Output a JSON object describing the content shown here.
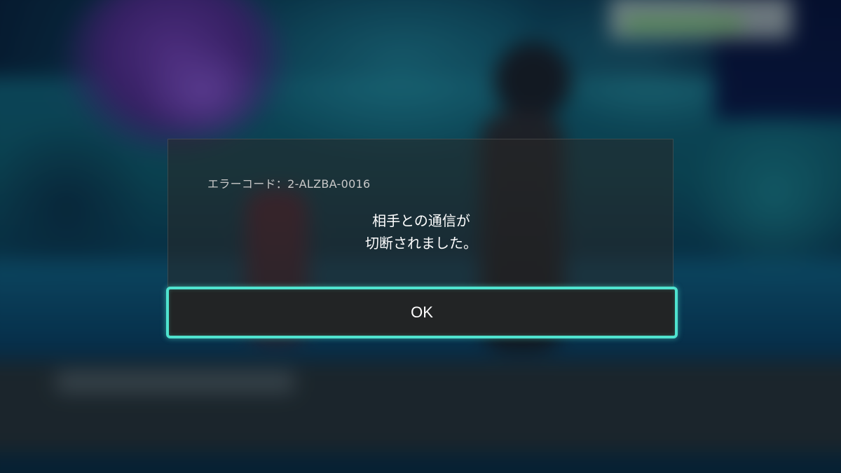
{
  "dialog": {
    "error_code": "エラーコード：2-ALZBA-0016",
    "message_lines": [
      "相手との通信が",
      "切断されました。"
    ],
    "ok_label": "OK"
  },
  "colors": {
    "button_border": "#4fe3cf",
    "button_bg": "#222425",
    "text": "#ffffff"
  }
}
